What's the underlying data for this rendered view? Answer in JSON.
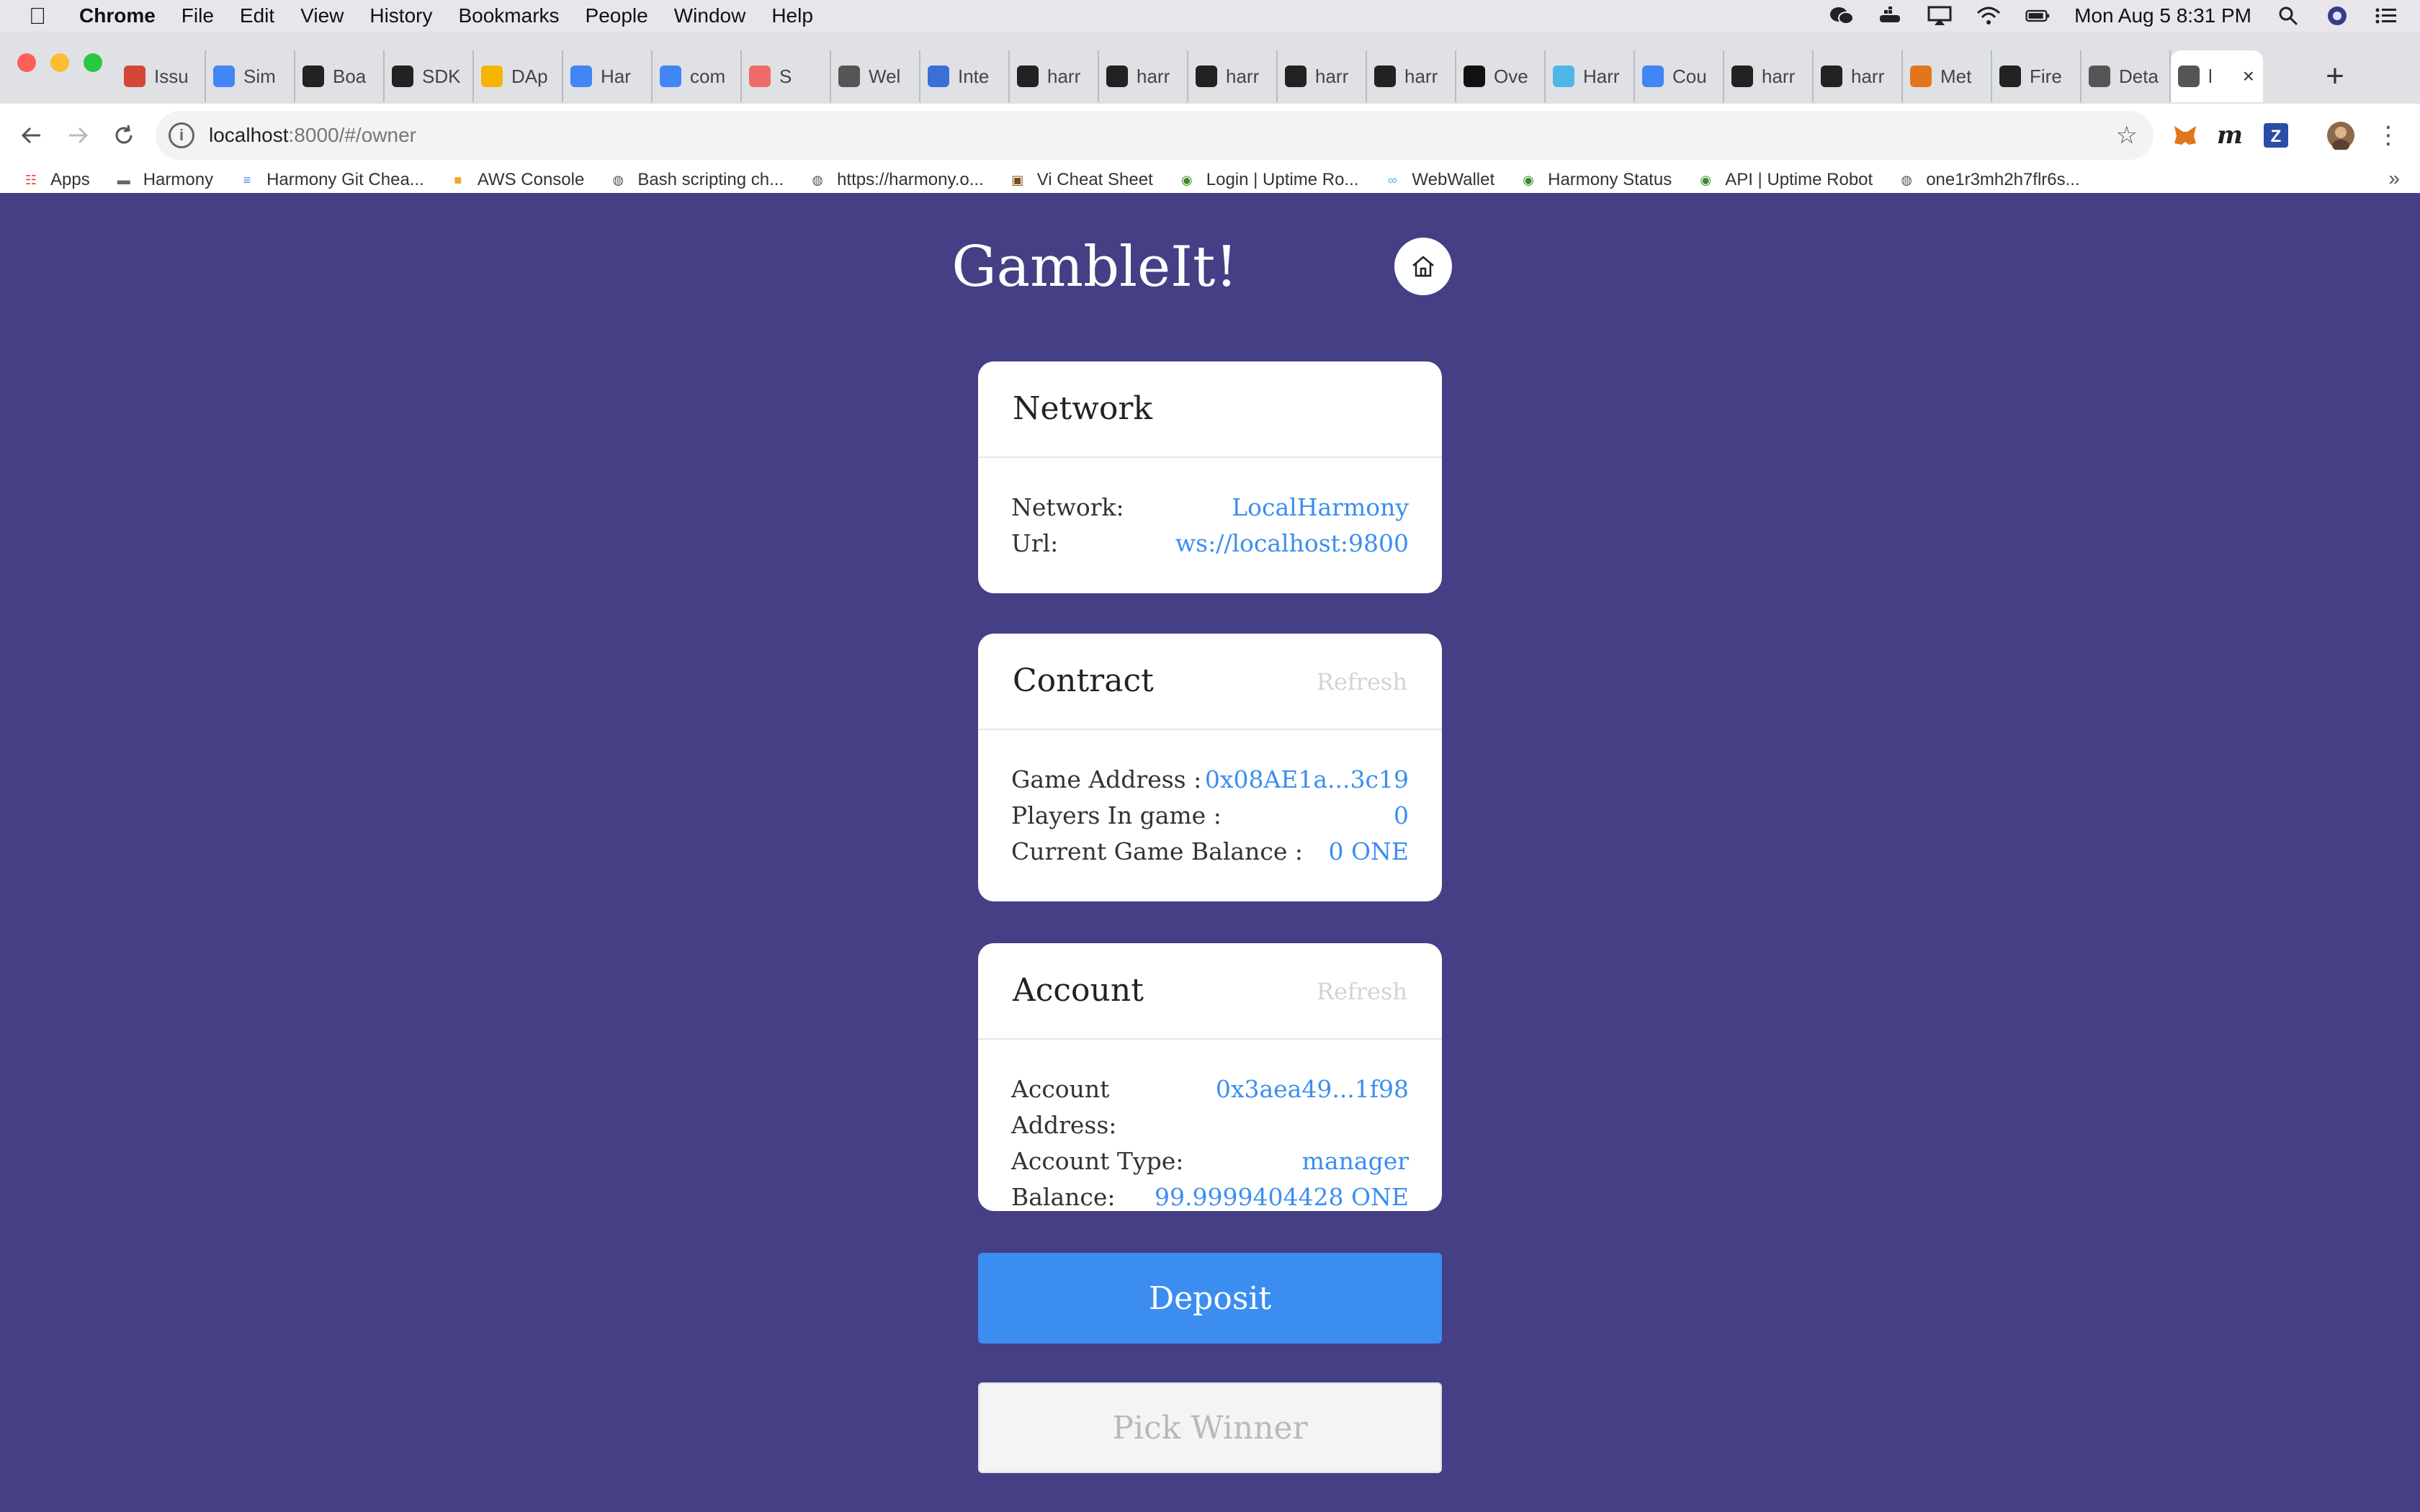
{
  "menubar": {
    "app": "Chrome",
    "items": [
      "File",
      "Edit",
      "View",
      "History",
      "Bookmarks",
      "People",
      "Window",
      "Help"
    ],
    "clock": "Mon Aug 5  8:31 PM"
  },
  "tabs": [
    {
      "label": "Issu",
      "icon": "gmail-icon",
      "color": "#d44638"
    },
    {
      "label": "Sim",
      "icon": "calendar-icon",
      "color": "#4285f4"
    },
    {
      "label": "Boa",
      "icon": "github-icon",
      "color": "#222222"
    },
    {
      "label": "SDK",
      "icon": "github-icon",
      "color": "#222222"
    },
    {
      "label": "DAp",
      "icon": "drive-icon",
      "color": "#f4b400"
    },
    {
      "label": "Har",
      "icon": "docs-icon",
      "color": "#4285f4"
    },
    {
      "label": "com",
      "icon": "docs-icon",
      "color": "#4285f4"
    },
    {
      "label": "S",
      "icon": "asana-icon",
      "color": "#f06a6a"
    },
    {
      "label": "Wel",
      "icon": "globe-icon",
      "color": "#555555"
    },
    {
      "label": "Inte",
      "icon": "layers-icon",
      "color": "#3a6fd8"
    },
    {
      "label": "harr",
      "icon": "github-icon",
      "color": "#222222"
    },
    {
      "label": "harr",
      "icon": "github-icon",
      "color": "#222222"
    },
    {
      "label": "harr",
      "icon": "github-icon",
      "color": "#222222"
    },
    {
      "label": "harr",
      "icon": "github-icon",
      "color": "#222222"
    },
    {
      "label": "harr",
      "icon": "github-icon",
      "color": "#222222"
    },
    {
      "label": "Ove",
      "icon": "notion-icon",
      "color": "#111111"
    },
    {
      "label": "Harr",
      "icon": "harmony-icon",
      "color": "#4fb7e6"
    },
    {
      "label": "Cou",
      "icon": "google-icon",
      "color": "#4285f4"
    },
    {
      "label": "harr",
      "icon": "github-icon",
      "color": "#222222"
    },
    {
      "label": "harr",
      "icon": "github-icon",
      "color": "#222222"
    },
    {
      "label": "Met",
      "icon": "metamask-icon",
      "color": "#e2761b"
    },
    {
      "label": "Fire",
      "icon": "github-icon",
      "color": "#222222"
    },
    {
      "label": "Deta",
      "icon": "globe-icon",
      "color": "#555555"
    },
    {
      "label": "l",
      "icon": "globe-icon",
      "color": "#555555",
      "active": true
    }
  ],
  "address": {
    "host": "localhost",
    "path": ":8000/#/owner"
  },
  "bookmarks": [
    {
      "label": "Apps",
      "icon": "apps-grid-icon"
    },
    {
      "label": "Harmony",
      "icon": "folder-icon"
    },
    {
      "label": "Harmony Git Chea...",
      "icon": "docs-icon"
    },
    {
      "label": "AWS Console",
      "icon": "aws-box-icon"
    },
    {
      "label": "Bash scripting ch...",
      "icon": "globe-icon"
    },
    {
      "label": "https://harmony.o...",
      "icon": "globe-icon"
    },
    {
      "label": "Vi Cheat Sheet",
      "icon": "vi-icon"
    },
    {
      "label": "Login | Uptime Ro...",
      "icon": "uptime-icon"
    },
    {
      "label": "WebWallet",
      "icon": "harmony-icon"
    },
    {
      "label": "Harmony Status",
      "icon": "uptime-icon"
    },
    {
      "label": "API | Uptime Robot",
      "icon": "uptime-icon"
    },
    {
      "label": "one1r3mh2h7flr6s...",
      "icon": "globe-icon"
    }
  ],
  "app": {
    "title": "GambleIt!",
    "network": {
      "heading": "Network",
      "rows": [
        {
          "key": "Network:",
          "value": "LocalHarmony"
        },
        {
          "key": "Url:",
          "value": "ws://localhost:9800"
        }
      ]
    },
    "contract": {
      "heading": "Contract",
      "refresh": "Refresh",
      "rows": [
        {
          "key": "Game Address :",
          "value": "0x08AE1a...3c19"
        },
        {
          "key": "Players In game :",
          "value": "0"
        },
        {
          "key": "Current Game Balance :",
          "value": "0 ONE"
        }
      ]
    },
    "account": {
      "heading": "Account",
      "refresh": "Refresh",
      "rows": [
        {
          "key": "Account Address:",
          "value": "0x3aea49...1f98"
        },
        {
          "key": "Account Type:",
          "value": "manager"
        },
        {
          "key": "Balance:",
          "value": "99.9999404428 ONE"
        }
      ]
    },
    "deposit_label": "Deposit",
    "pick_winner_label": "Pick Winner"
  },
  "colors": {
    "page_background": "#453f85",
    "accent": "#3b8ef0"
  }
}
